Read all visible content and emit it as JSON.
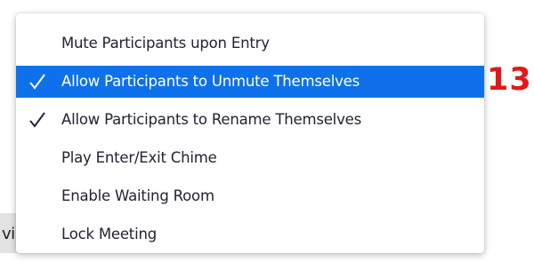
{
  "background": {
    "left_text": "vi"
  },
  "menu": {
    "items": [
      {
        "label": "Mute Participants upon Entry",
        "checked": false,
        "selected": false
      },
      {
        "label": "Allow Participants to Unmute Themselves",
        "checked": true,
        "selected": true
      },
      {
        "label": "Allow Participants to Rename Themselves",
        "checked": true,
        "selected": false
      },
      {
        "label": "Play Enter/Exit Chime",
        "checked": false,
        "selected": false
      },
      {
        "label": "Enable Waiting Room",
        "checked": false,
        "selected": false
      },
      {
        "label": "Lock Meeting",
        "checked": false,
        "selected": false
      }
    ]
  },
  "annotation": {
    "text": "13"
  },
  "colors": {
    "highlight": "#0e71eb",
    "annotation": "#e21818",
    "menu_text": "#232333"
  },
  "icons": {
    "check": "checkmark-icon"
  }
}
